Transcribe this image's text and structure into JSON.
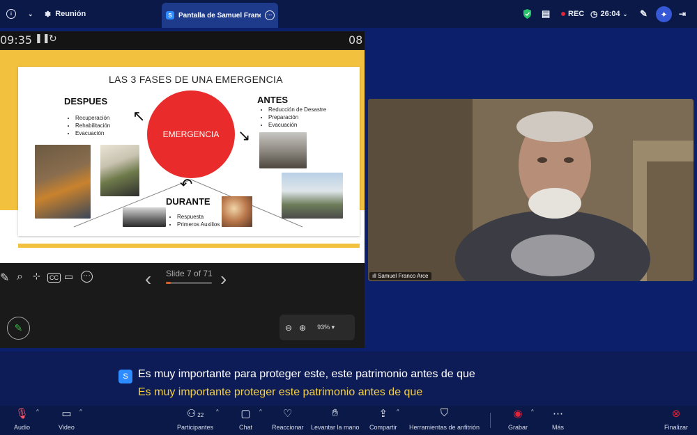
{
  "topbar": {
    "meeting_label": "Reunión",
    "tab_title": "Pantalla de Samuel Franco Arce",
    "tab_badge": "S",
    "rec_label": "REC",
    "timer": "26:04"
  },
  "share": {
    "timer_left": "09:35",
    "timer_right": "08",
    "slide": {
      "title": "LAS 3 FASES DE UNA EMERGENCIA",
      "center_label": "EMERGENCIA",
      "despues": {
        "heading": "DESPUES",
        "items": [
          "Recuperación",
          "Rehabilitación",
          "Evacuación"
        ]
      },
      "antes": {
        "heading": "ANTES",
        "items": [
          "Reducción de Desastre",
          "Preparación",
          "Evacuación"
        ]
      },
      "durante": {
        "heading": "DURANTE",
        "items": [
          "Respuesta",
          "Primeros Auxilios"
        ]
      }
    },
    "slide_counter": "Slide 7 of 71",
    "slide_progress": 0.0986,
    "zoom": "93%"
  },
  "video": {
    "participant_name": "Samuel Franco Arce"
  },
  "captions": {
    "badge": "S",
    "line1": "Es muy importante para proteger este, este patrimonio antes de que",
    "line2": "Es muy importante proteger este patrimonio antes de que"
  },
  "toolbar": {
    "audio": "Audio",
    "video": "Video",
    "participants": "Participantes",
    "participants_count": "22",
    "chat": "Chat",
    "react": "Reaccionar",
    "raise_hand": "Levantar la mano",
    "share": "Compartir",
    "host_tools": "Herramientas de anfitrión",
    "record": "Grabar",
    "more": "Más",
    "end": "Finalizar"
  },
  "colors": {
    "accent": "#2d8cff",
    "caption_highlight": "#f3cf45",
    "rec": "#e0243a",
    "slide_yellow": "#f2c23e",
    "slide_red": "#e92c2b"
  }
}
